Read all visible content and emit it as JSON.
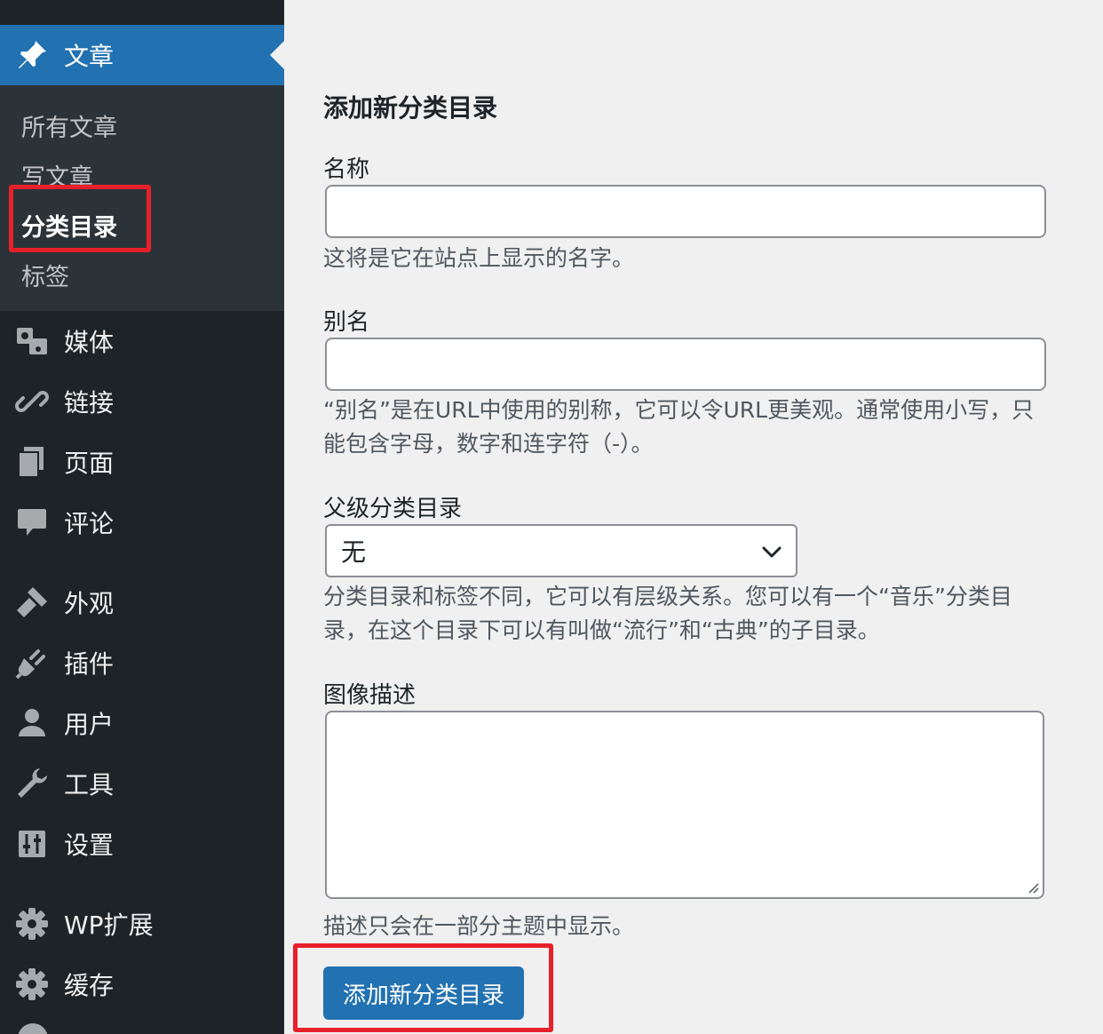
{
  "sidebar": {
    "posts": {
      "label": "文章",
      "icon": "pin-icon"
    },
    "submenu": [
      {
        "label": "所有文章"
      },
      {
        "label": "写文章"
      },
      {
        "label": "分类目录",
        "current": true
      },
      {
        "label": "标签"
      }
    ],
    "items": [
      {
        "label": "媒体",
        "icon": "media-icon"
      },
      {
        "label": "链接",
        "icon": "link-icon"
      },
      {
        "label": "页面",
        "icon": "page-icon"
      },
      {
        "label": "评论",
        "icon": "comment-icon"
      },
      {
        "label": "外观",
        "icon": "appearance-icon"
      },
      {
        "label": "插件",
        "icon": "plugin-icon"
      },
      {
        "label": "用户",
        "icon": "user-icon"
      },
      {
        "label": "工具",
        "icon": "wrench-icon"
      },
      {
        "label": "设置",
        "icon": "settings-icon"
      },
      {
        "label": "WP扩展",
        "icon": "gear-icon"
      },
      {
        "label": "缓存",
        "icon": "gear-icon"
      }
    ]
  },
  "form": {
    "title": "添加新分类目录",
    "name_label": "名称",
    "name_value": "",
    "name_desc": "这将是它在站点上显示的名字。",
    "slug_label": "别名",
    "slug_value": "",
    "slug_desc": "“别名”是在URL中使用的别称，它可以令URL更美观。通常使用小写，只能包含字母，数字和连字符（-）。",
    "parent_label": "父级分类目录",
    "parent_selected": "无",
    "parent_desc": "分类目录和标签不同，它可以有层级关系。您可以有一个“音乐”分类目录，在这个目录下可以有叫做“流行”和“古典”的子目录。",
    "image_desc_label": "图像描述",
    "image_desc_value": "",
    "image_desc_help": "描述只会在一部分主题中显示。",
    "submit_label": "添加新分类目录"
  },
  "colors": {
    "accent": "#2271b1",
    "highlight": "#e8202a",
    "sidebar": "#1d2327"
  }
}
